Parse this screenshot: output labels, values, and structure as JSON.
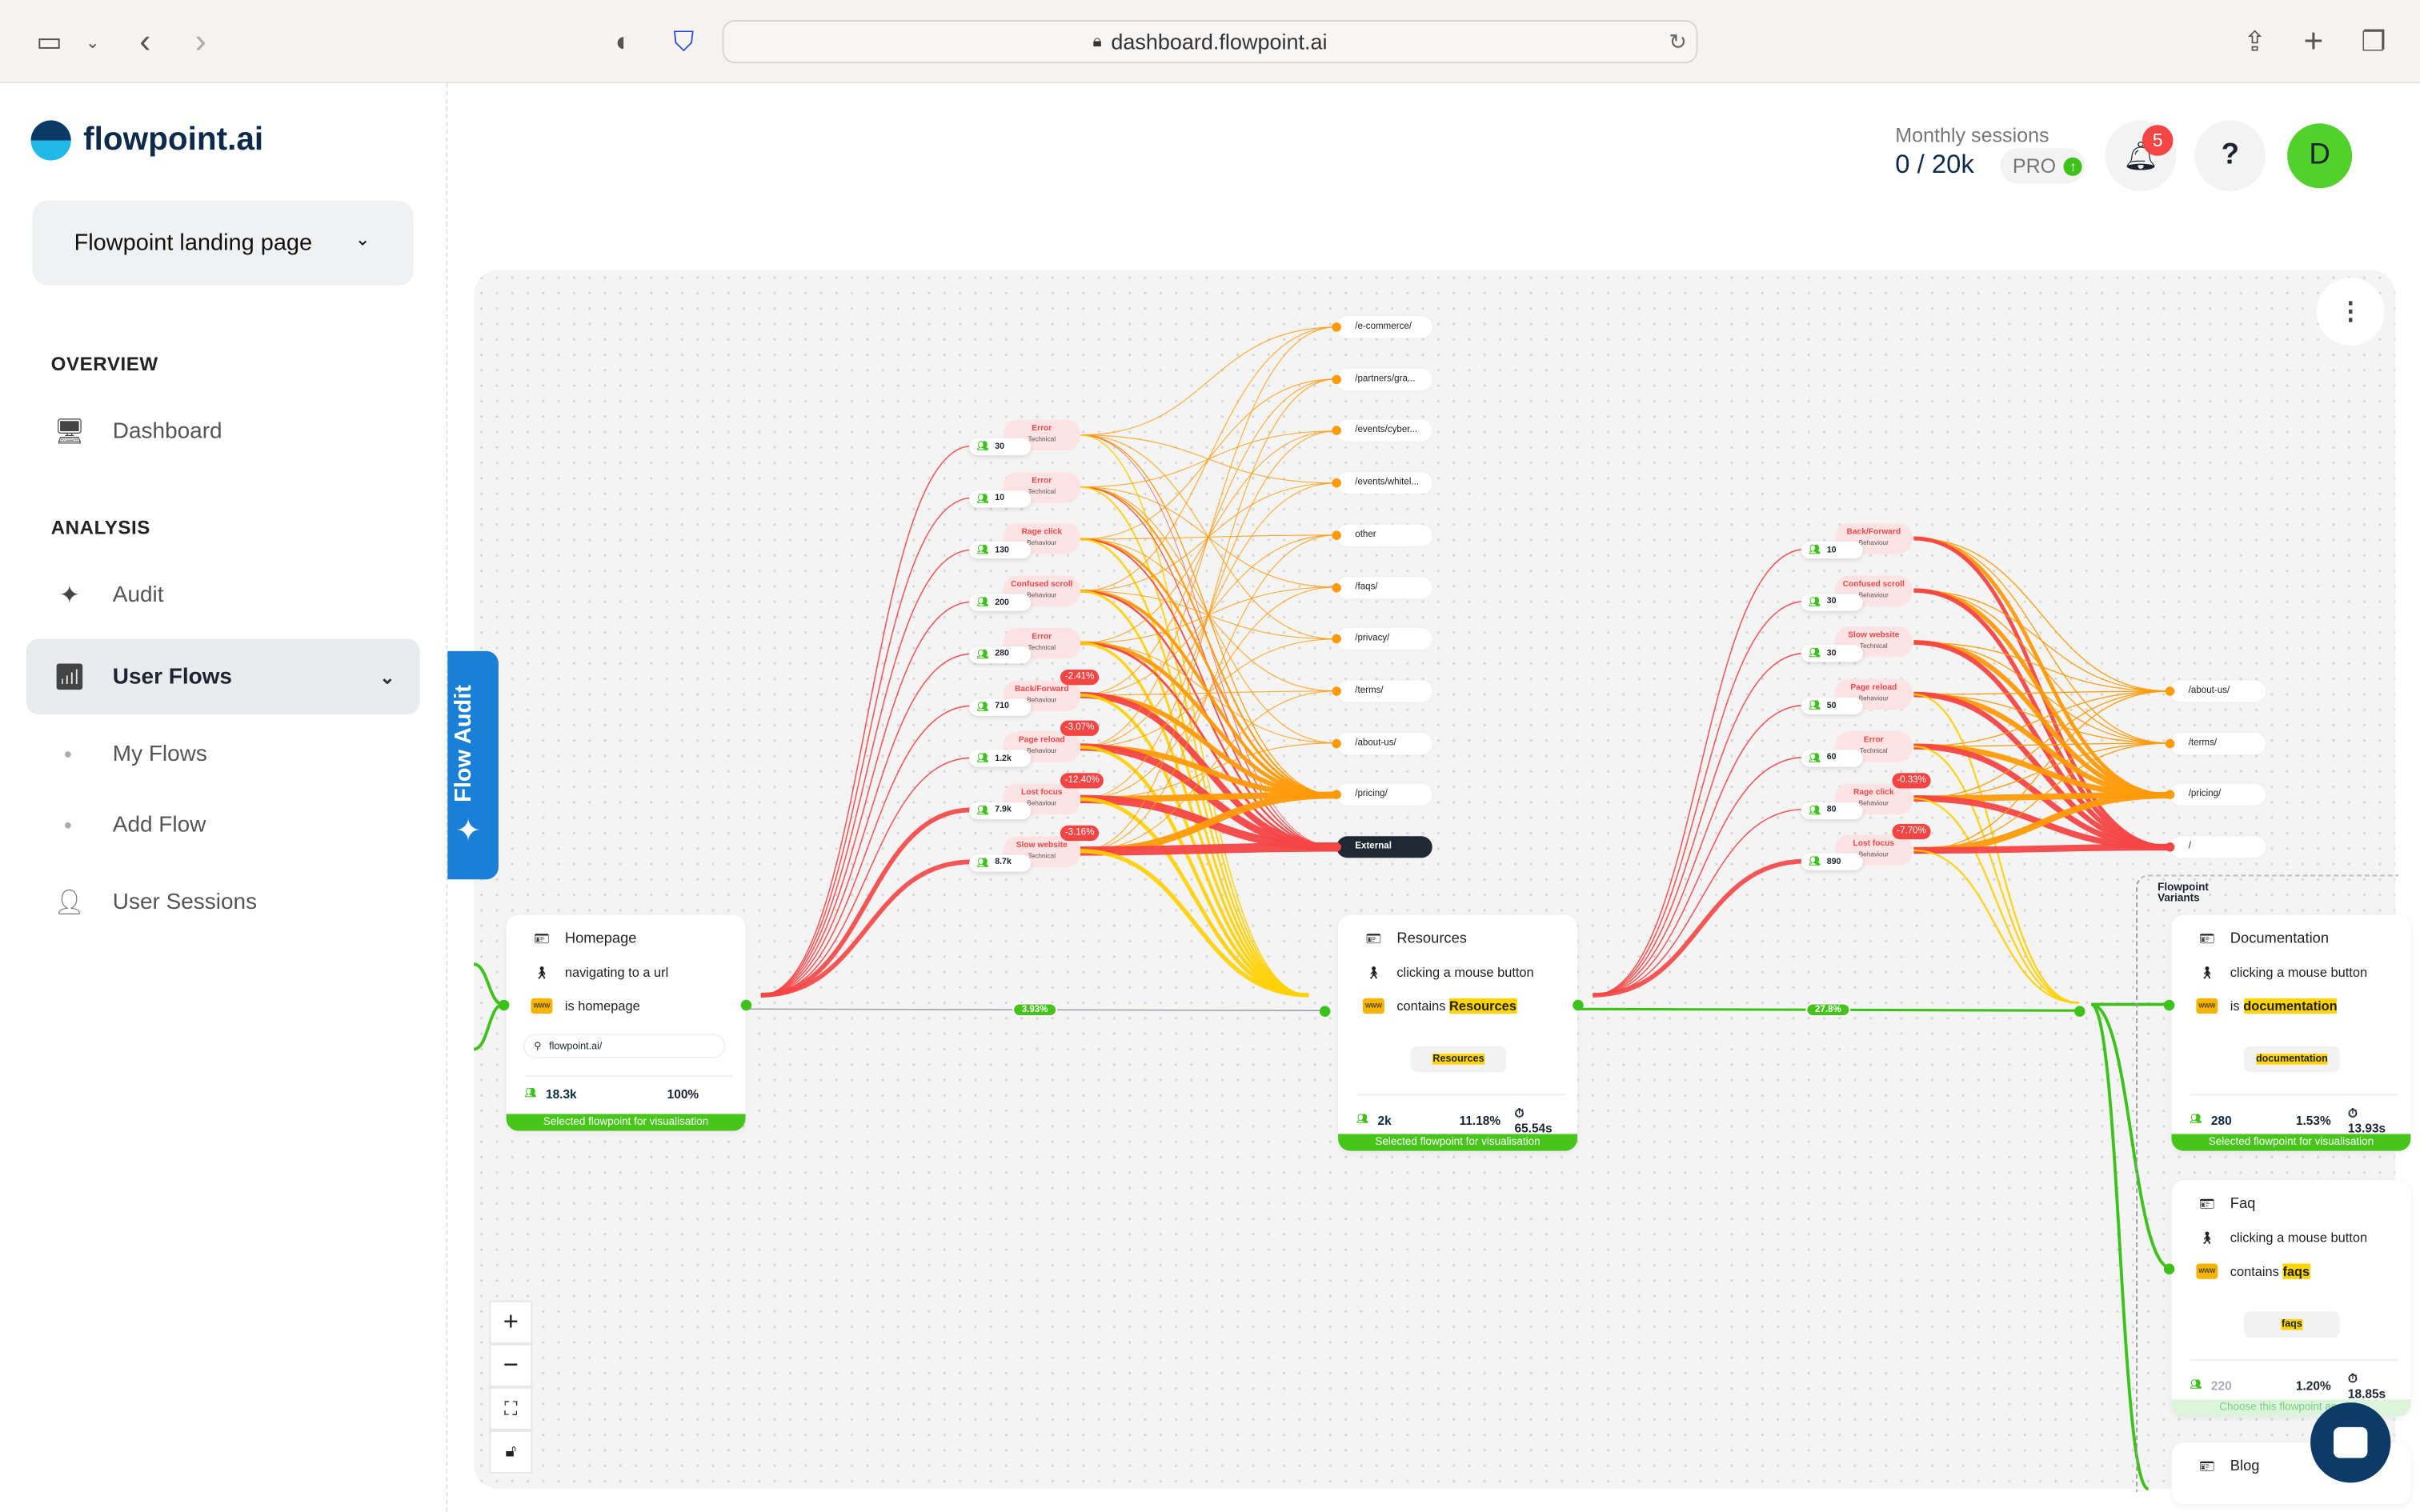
{
  "browser": {
    "url": "dashboard.flowpoint.ai"
  },
  "sidebar": {
    "logo": "flowpoint.ai",
    "project": "Flowpoint landing page",
    "overview_title": "OVERVIEW",
    "analysis_title": "ANALYSIS",
    "items": [
      {
        "label": "Dashboard",
        "icon": "monitor-icon"
      },
      {
        "label": "Audit",
        "icon": "sparkle-icon"
      },
      {
        "label": "User Flows",
        "icon": "chart-icon",
        "selected": true
      },
      {
        "label": "My Flows"
      },
      {
        "label": "Add Flow"
      },
      {
        "label": "User Sessions",
        "icon": "person-icon"
      }
    ]
  },
  "flow_audit_tab": "Flow Audit",
  "header": {
    "sessions_label": "Monthly sessions",
    "sessions_used": "0",
    "sessions_limit": "/ 20k",
    "plan": "PRO",
    "notifications": "5",
    "help": "?",
    "avatar": "D"
  },
  "colors": {
    "accent": "#3cc21a",
    "issue": "#f04848",
    "tab": "#1a7fd6",
    "highlight": "#ffd400"
  },
  "flow": {
    "issues_left": [
      {
        "name": "Error",
        "category": "Technical",
        "count": "30"
      },
      {
        "name": "Error",
        "category": "Technical",
        "count": "10"
      },
      {
        "name": "Rage click",
        "category": "Behaviour",
        "count": "130"
      },
      {
        "name": "Confused scroll",
        "category": "Behaviour",
        "count": "200"
      },
      {
        "name": "Error",
        "category": "Technical",
        "count": "280"
      },
      {
        "name": "Back/Forward",
        "category": "Behaviour",
        "count": "710",
        "change": "-2.41%"
      },
      {
        "name": "Page reload",
        "category": "Behaviour",
        "count": "1.2k",
        "change": "-3.07%"
      },
      {
        "name": "Lost focus",
        "category": "Behaviour",
        "count": "7.9k",
        "change": "-12.40%"
      },
      {
        "name": "Slow website",
        "category": "Technical",
        "count": "8.7k",
        "change": "-3.16%"
      }
    ],
    "urls_mid": [
      "/e-commerce/",
      "/partners/gra...",
      "/events/cyber...",
      "/events/whitel...",
      "other",
      "/faqs/",
      "/privacy/",
      "/terms/",
      "/about-us/",
      "/pricing/",
      "External"
    ],
    "issues_right": [
      {
        "name": "Back/Forward",
        "category": "Behaviour",
        "count": "10"
      },
      {
        "name": "Confused scroll",
        "category": "Behaviour",
        "count": "30"
      },
      {
        "name": "Slow website",
        "category": "Technical",
        "count": "30"
      },
      {
        "name": "Page reload",
        "category": "Behaviour",
        "count": "50"
      },
      {
        "name": "Error",
        "category": "Technical",
        "count": "60"
      },
      {
        "name": "Rage click",
        "category": "Behaviour",
        "count": "80",
        "change": "-0.33%"
      },
      {
        "name": "Lost focus",
        "category": "Behaviour",
        "count": "890",
        "change": "-7.70%"
      }
    ],
    "urls_right": [
      "/about-us/",
      "/terms/",
      "/pricing/",
      "/"
    ],
    "edge_labels": [
      "3.93%",
      "27.8%"
    ],
    "homepage": {
      "title": "Homepage",
      "action": "navigating to a url",
      "condition": "is homepage",
      "search": "flowpoint.ai/",
      "users": "18.3k",
      "percent": "100%",
      "footer": "Selected flowpoint for visualisation"
    },
    "resources": {
      "title": "Resources",
      "action": "clicking a mouse button",
      "cond_prefix": "contains",
      "cond_value": "Resources",
      "tag": "Resources",
      "users": "2k",
      "percent": "11.18%",
      "time": "65.54s",
      "footer": "Selected flowpoint for visualisation"
    },
    "variants_title": "Flowpoint Variants",
    "variants": [
      {
        "title": "Documentation",
        "action": "clicking a mouse button",
        "cond_prefix": "is",
        "cond_value": "documentation",
        "tag": "documentation",
        "users": "280",
        "percent": "1.53%",
        "time": "13.93s",
        "footer": "Selected flowpoint for visualisation",
        "selected": true
      },
      {
        "title": "Faq",
        "action": "clicking a mouse button",
        "cond_prefix": "contains",
        "cond_value": "faqs",
        "tag": "faqs",
        "users": "220",
        "percent": "1.20%",
        "time": "18.85s",
        "footer": "Choose this flowpoint as main",
        "selected": false
      },
      {
        "title": "Blog"
      }
    ]
  }
}
